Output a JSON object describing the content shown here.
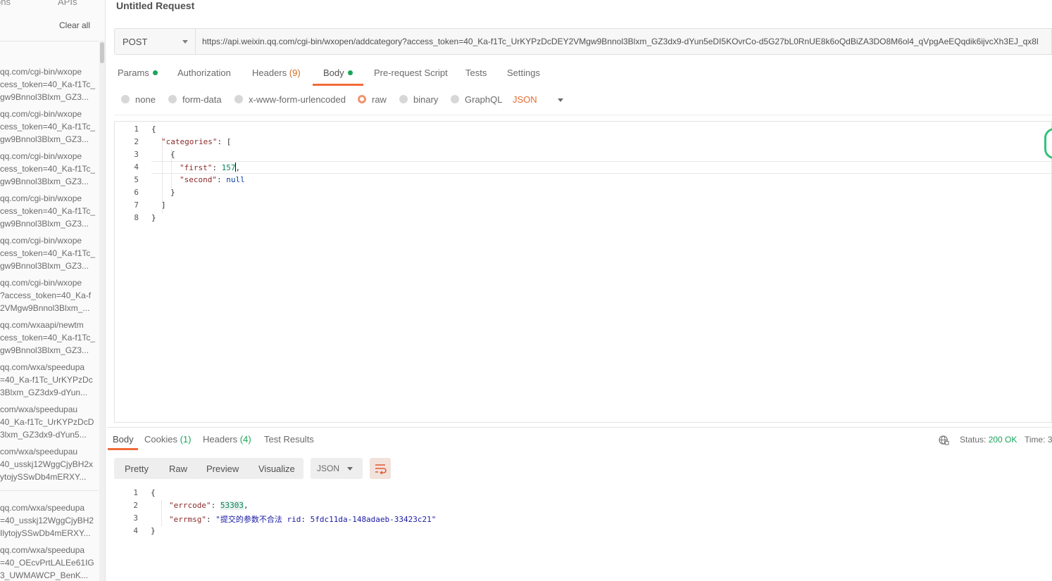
{
  "sidebar": {
    "tab_history": "ons",
    "tab_apis": "APIs",
    "clear_all": "Clear all",
    "history": [
      [
        "qq.com/cgi-bin/wxope",
        "cess_token=40_Ka-f1Tc_",
        "gw9Bnnol3Blxm_GZ3..."
      ],
      [
        "qq.com/cgi-bin/wxope",
        "cess_token=40_Ka-f1Tc_",
        "gw9Bnnol3Blxm_GZ3..."
      ],
      [
        "qq.com/cgi-bin/wxope",
        "cess_token=40_Ka-f1Tc_",
        "gw9Bnnol3Blxm_GZ3..."
      ],
      [
        "qq.com/cgi-bin/wxope",
        "cess_token=40_Ka-f1Tc_",
        "gw9Bnnol3Blxm_GZ3..."
      ],
      [
        "qq.com/cgi-bin/wxope",
        "cess_token=40_Ka-f1Tc_",
        "gw9Bnnol3Blxm_GZ3..."
      ],
      [
        "qq.com/cgi-bin/wxope",
        "?access_token=40_Ka-f",
        "2VMgw9Bnnol3Blxm_..."
      ],
      [
        "qq.com/wxaapi/newtm",
        "cess_token=40_Ka-f1Tc_",
        "gw9Bnnol3Blxm_GZ3..."
      ],
      [
        "qq.com/wxa/speedupa",
        "=40_Ka-f1Tc_UrKYPzDc",
        "3Blxm_GZ3dx9-dYun..."
      ],
      [
        "com/wxa/speedupau",
        "40_Ka-f1Tc_UrKYPzDcD",
        "3lxm_GZ3dx9-dYun5..."
      ],
      [
        "com/wxa/speedupau",
        "40_usskj12WggCjyBH2x",
        "ytojySSwDb4mERXY..."
      ],
      [
        "qq.com/wxa/speedupa",
        "=40_usskj12WggCjyBH2",
        "IlytojySSwDb4mERXY..."
      ],
      [
        "qq.com/wxa/speedupa",
        "=40_OEcvPrtLALEe61IG",
        "3_UWMAWCP_BenK..."
      ]
    ]
  },
  "request": {
    "title": "Untitled Request",
    "method": "POST",
    "url": "https://api.weixin.qq.com/cgi-bin/wxopen/addcategory?access_token=40_Ka-f1Tc_UrKYPzDcDEY2VMgw9Bnnol3Blxm_GZ3dx9-dYun5eDI5KOvrCo-d5G27bL0RnUE8k6oQdBiZA3DO8M6ol4_qVpgAeEQqdik6ijvcXh3EJ_qx8l"
  },
  "req_tabs": {
    "params": "Params",
    "authorization": "Authorization",
    "headers": "Headers",
    "headers_count": "(9)",
    "body": "Body",
    "prerequest": "Pre-request Script",
    "tests": "Tests",
    "settings": "Settings"
  },
  "body_types": {
    "none": "none",
    "form_data": "form-data",
    "urlencoded": "x-www-form-urlencoded",
    "raw": "raw",
    "binary": "binary",
    "graphql": "GraphQL",
    "lang": "JSON"
  },
  "editor": {
    "line_numbers": [
      "1",
      "2",
      "3",
      "4",
      "5",
      "6",
      "7",
      "8"
    ],
    "l1": "{",
    "l2_key": "\"categories\"",
    "l2_rest": ": [",
    "l3": "{",
    "l4_key": "\"first\"",
    "l4_colon": ": ",
    "l4_val": "157",
    "l4_comma": ",",
    "l5_key": "\"second\"",
    "l5_colon": ": ",
    "l5_val": "null",
    "l6": "}",
    "l7": "]",
    "l8": "}"
  },
  "response": {
    "tabs": {
      "body": "Body",
      "cookies": "Cookies",
      "cookies_count": "(1)",
      "headers": "Headers",
      "headers_count": "(4)",
      "test_results": "Test Results"
    },
    "status_label": "Status:",
    "status_value": "200 OK",
    "time_label": "Time: 3",
    "views": {
      "pretty": "Pretty",
      "raw": "Raw",
      "preview": "Preview",
      "visualize": "Visualize"
    },
    "format": "JSON",
    "line_numbers": [
      "1",
      "2",
      "3",
      "4"
    ],
    "l1": "{",
    "l2_key": "\"errcode\"",
    "l2_colon": ": ",
    "l2_val": "53303",
    "l2_comma": ",",
    "l3_key": "\"errmsg\"",
    "l3_colon": ": ",
    "l3_val": "\"提交的参数不合法 rid: 5fdc11da-148adaeb-33423c21\"",
    "l4": "}"
  },
  "colors": {
    "accent": "#f26b3a",
    "success": "#1aa55a",
    "json_lang": "#e76b33"
  }
}
